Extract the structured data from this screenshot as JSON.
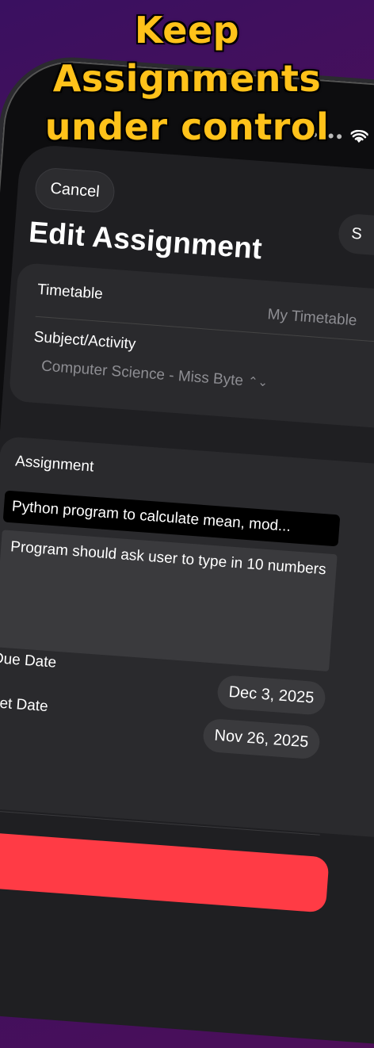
{
  "promo": {
    "line1": "Keep",
    "line2": "Assignments",
    "line3": "under control"
  },
  "nav": {
    "cancel_label": "Cancel",
    "save_label": "S",
    "title": "Edit Assignment"
  },
  "form": {
    "timetable_label": "Timetable",
    "timetable_value": "My Timetable",
    "subject_label": "Subject/Activity",
    "subject_value": "Computer Science - Miss Byte",
    "assignment_label": "Assignment",
    "assignment_title": "Python program to calculate mean, mod...",
    "assignment_notes": "Program should ask user to type in 10 numbers",
    "due_date_label": "Due Date",
    "due_date_value": "Dec 3, 2025",
    "set_date_label": "Set Date",
    "set_date_value": "Nov 26, 2025"
  },
  "colors": {
    "accent": "#ffc21a",
    "background": "#1f1f22",
    "danger": "#ff3b45"
  }
}
